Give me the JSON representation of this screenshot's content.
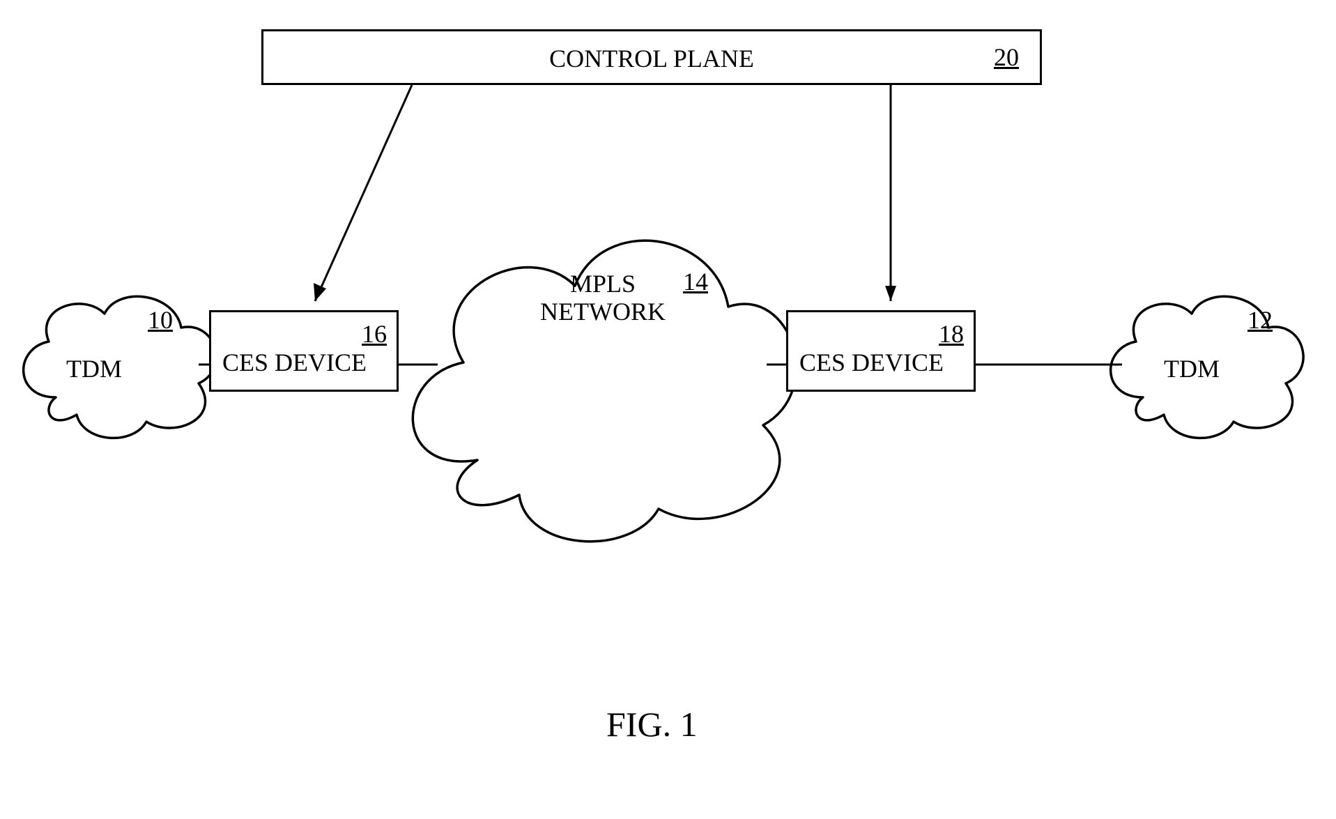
{
  "controlPlane": {
    "label": "CONTROL PLANE",
    "ref": "20"
  },
  "tdmLeft": {
    "label": "TDM",
    "ref": "10"
  },
  "tdmRight": {
    "label": "TDM",
    "ref": "12"
  },
  "cesLeft": {
    "label": "CES DEVICE",
    "ref": "16"
  },
  "cesRight": {
    "label": "CES DEVICE",
    "ref": "18"
  },
  "mpls": {
    "label": "MPLS\nNETWORK",
    "ref": "14"
  },
  "figure": {
    "label": "FIG. 1"
  }
}
